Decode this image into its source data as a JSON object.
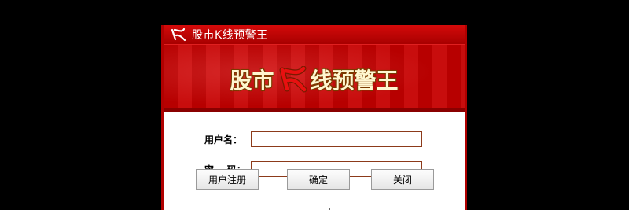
{
  "window": {
    "title": "股市K线预警王"
  },
  "banner": {
    "part1": "股市",
    "part2": "线预警王"
  },
  "form": {
    "username_label": "用户名：",
    "password_label": "密    码：",
    "username_value": "",
    "password_value": ""
  },
  "buttons": {
    "register": "用户注册",
    "confirm": "确定",
    "close": "关闭"
  },
  "colors": {
    "frame": "#c40404",
    "input_border": "#8c3a1a"
  }
}
